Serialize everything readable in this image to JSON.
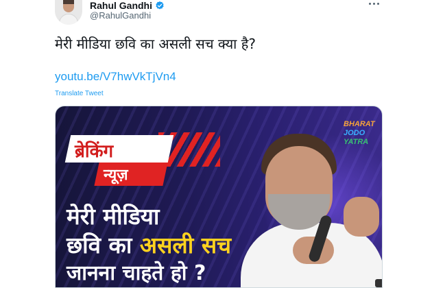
{
  "author": {
    "display_name": "Rahul Gandhi",
    "handle": "@RahulGandhi",
    "verified_color": "#1d9bf0"
  },
  "tweet": {
    "text": "मेरी मीडिया छवि का असली सच क्या है?",
    "link": "youtu.be/V7hwVkTjVn4",
    "translate_label": "Translate Tweet"
  },
  "media": {
    "badge_top": "ब्रेकिंग",
    "badge_bottom": "न्यूज़",
    "logo": {
      "line1": "BHARAT",
      "line2": "JODO",
      "line3": "YATRA"
    },
    "headline": {
      "line1": "मेरी मीडिया",
      "line2_prefix": "छवि का ",
      "line2_highlight": "असली सच",
      "line3": "जानना चाहते हो ?"
    }
  },
  "icons": {
    "more": "more-options-icon",
    "verified": "verified-badge-icon"
  }
}
